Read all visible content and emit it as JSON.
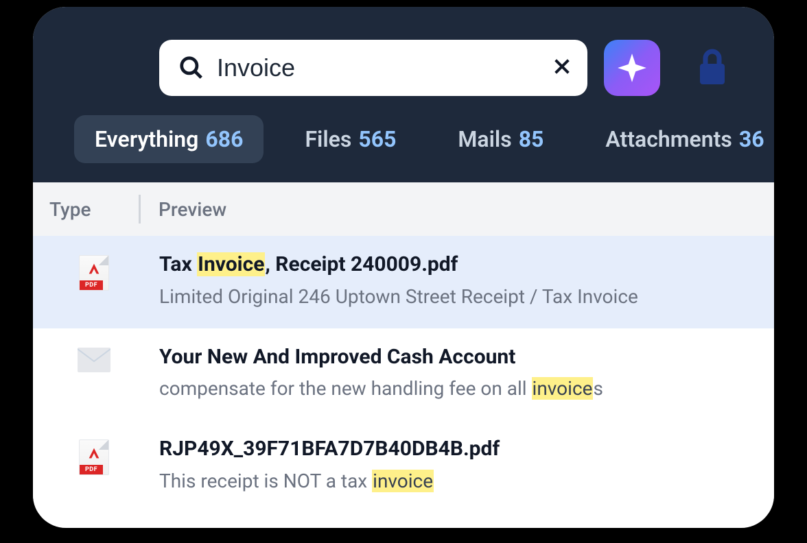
{
  "search": {
    "query": "Invoice",
    "placeholder": "Search"
  },
  "tabs": [
    {
      "label": "Everything",
      "count": "686",
      "active": true
    },
    {
      "label": "Files",
      "count": "565",
      "active": false
    },
    {
      "label": "Mails",
      "count": "85",
      "active": false
    },
    {
      "label": "Attachments",
      "count": "36",
      "active": false
    }
  ],
  "columns": {
    "type": "Type",
    "preview": "Preview"
  },
  "results": [
    {
      "icon": "pdf",
      "selected": true,
      "title_parts": [
        {
          "text": "Tax ",
          "hl": false
        },
        {
          "text": "Invoice",
          "hl": true
        },
        {
          "text": ", Receipt 240009.pdf",
          "hl": false
        }
      ],
      "preview_parts": [
        {
          "text": "Limited Original 246 Uptown Street Receipt / Tax Invoice",
          "hl": false
        }
      ]
    },
    {
      "icon": "mail",
      "selected": false,
      "title_parts": [
        {
          "text": "Your New And Improved Cash Account",
          "hl": false
        }
      ],
      "preview_parts": [
        {
          "text": "compensate for the new handling fee on all ",
          "hl": false
        },
        {
          "text": "invoice",
          "hl": true
        },
        {
          "text": "s",
          "hl": false
        }
      ]
    },
    {
      "icon": "pdf",
      "selected": false,
      "title_parts": [
        {
          "text": "RJP49X_39F71BFA7D7B40DB4B.pdf",
          "hl": false
        }
      ],
      "preview_parts": [
        {
          "text": "This receipt is NOT a tax ",
          "hl": false
        },
        {
          "text": "invoice",
          "hl": true
        }
      ]
    }
  ]
}
